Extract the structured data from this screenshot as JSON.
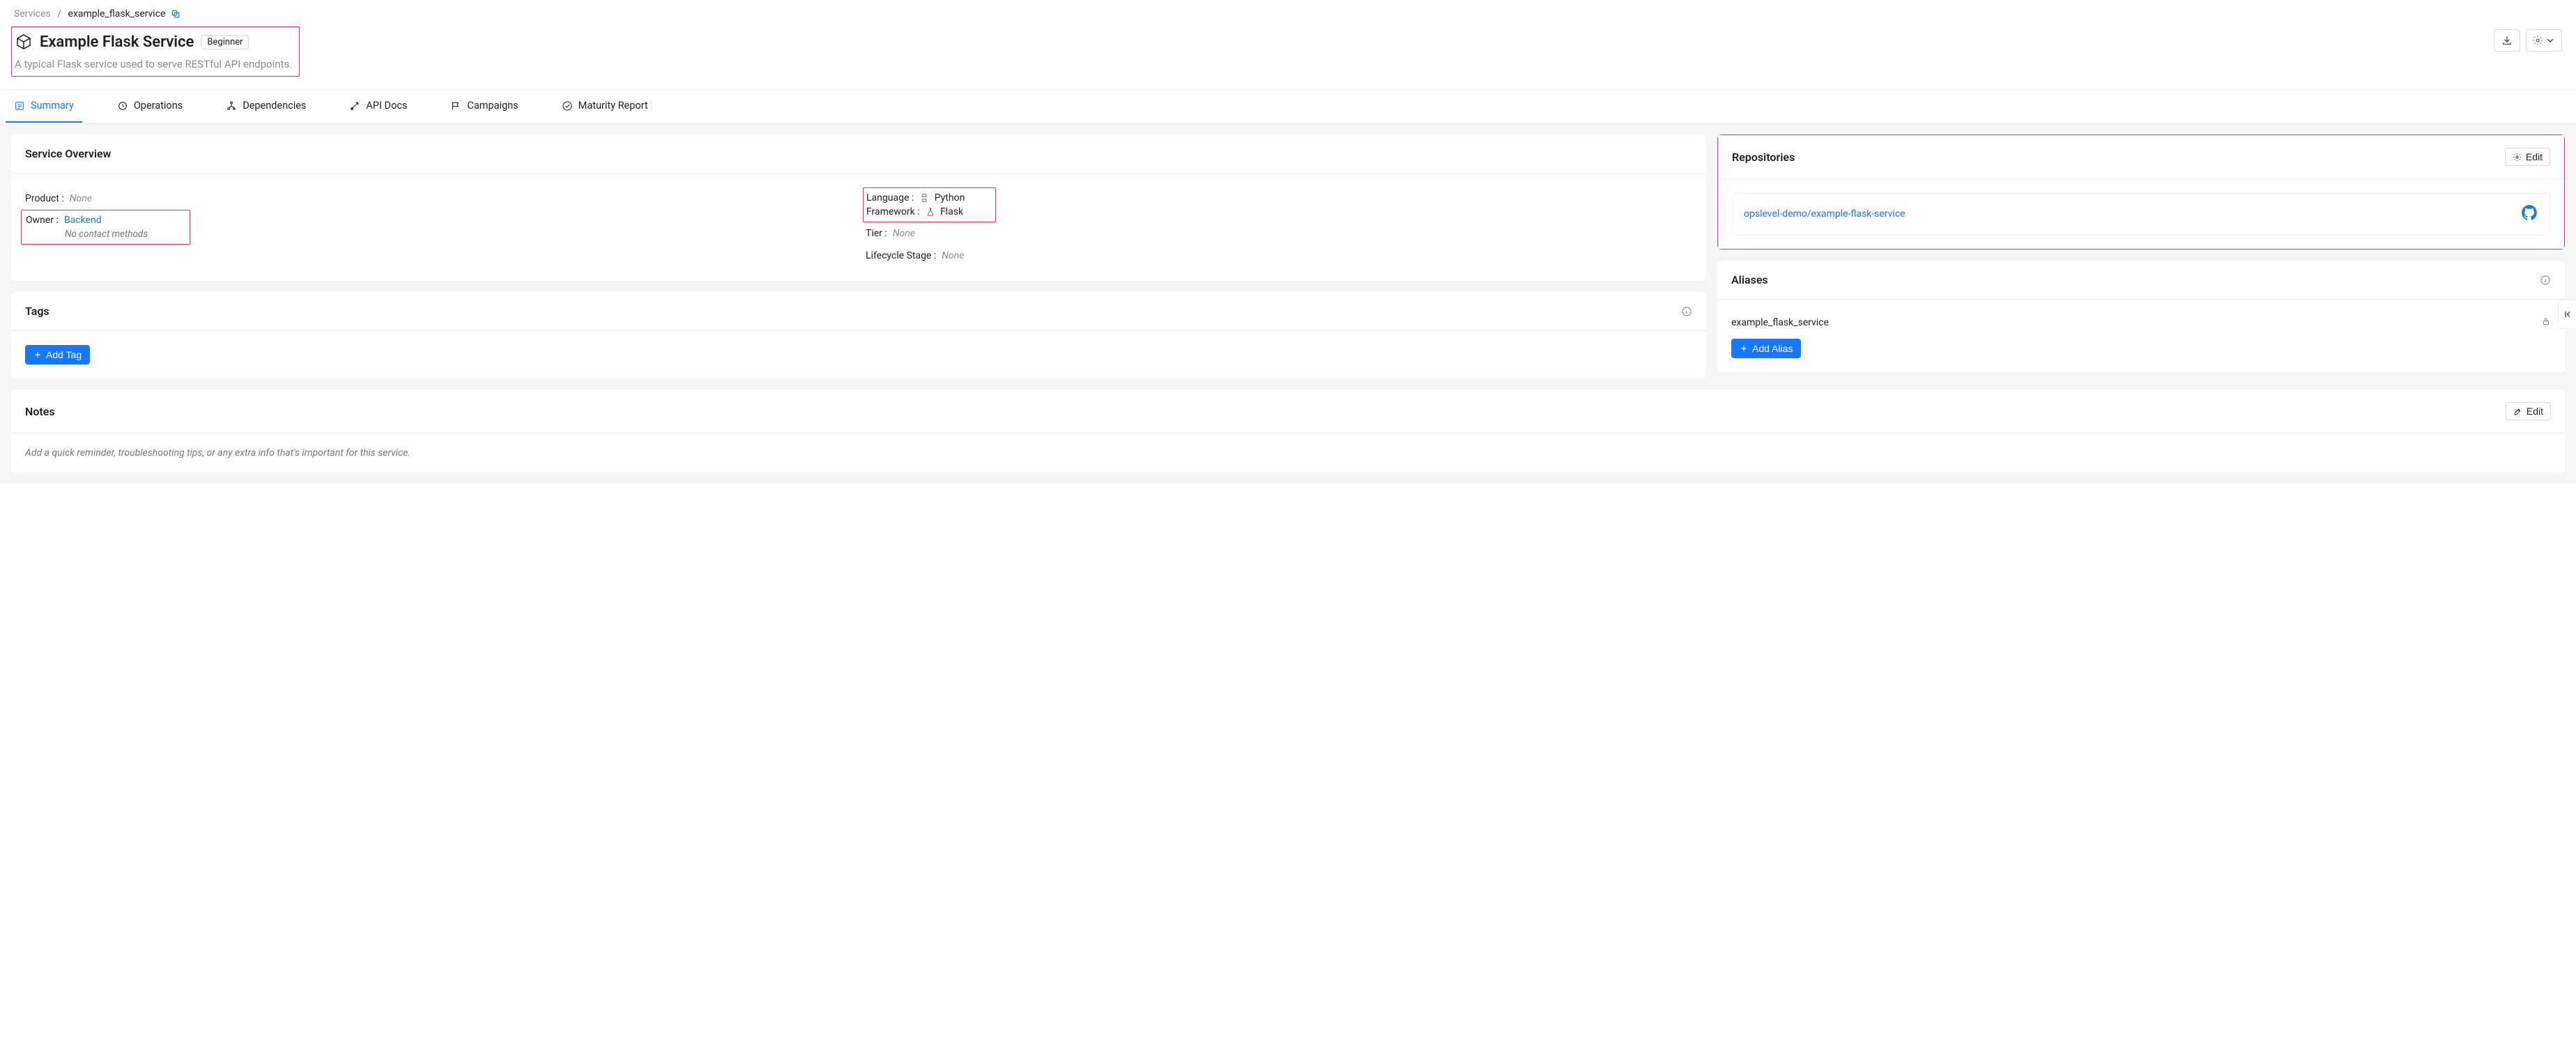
{
  "breadcrumb": {
    "root": "Services",
    "current": "example_flask_service"
  },
  "header": {
    "title": "Example Flask Service",
    "level_badge": "Beginner",
    "subtitle": "A typical Flask service used to serve RESTful API endpoints."
  },
  "tabs": [
    {
      "label": "Summary",
      "active": true
    },
    {
      "label": "Operations",
      "active": false
    },
    {
      "label": "Dependencies",
      "active": false
    },
    {
      "label": "API Docs",
      "active": false
    },
    {
      "label": "Campaigns",
      "active": false
    },
    {
      "label": "Maturity Report",
      "active": false
    }
  ],
  "overview": {
    "title": "Service Overview",
    "product": {
      "label": "Product",
      "value": "None",
      "muted": true
    },
    "owner": {
      "label": "Owner",
      "value": "Backend",
      "under": "No contact methods"
    },
    "language": {
      "label": "Language",
      "value": "Python"
    },
    "framework": {
      "label": "Framework",
      "value": "Flask"
    },
    "tier": {
      "label": "Tier",
      "value": "None",
      "muted": true
    },
    "lifecycle": {
      "label": "Lifecycle Stage",
      "value": "None",
      "muted": true
    }
  },
  "tags": {
    "title": "Tags",
    "add_label": "Add Tag"
  },
  "repositories": {
    "title": "Repositories",
    "edit_label": "Edit",
    "items": [
      {
        "name": "opslevel-demo/example-flask-service"
      }
    ]
  },
  "aliases": {
    "title": "Aliases",
    "value": "example_flask_service",
    "add_label": "Add Alias"
  },
  "notes": {
    "title": "Notes",
    "edit_label": "Edit",
    "placeholder": "Add a quick reminder, troubleshooting tips, or any extra info that's important for this service."
  }
}
